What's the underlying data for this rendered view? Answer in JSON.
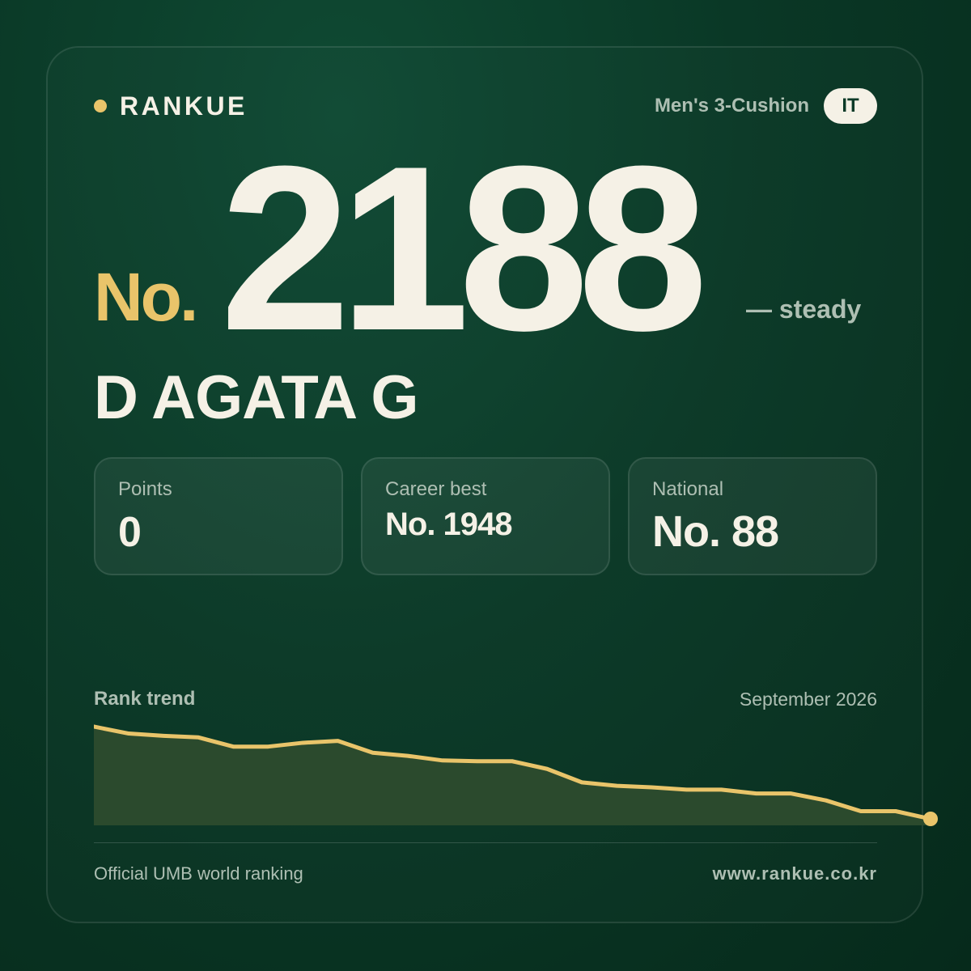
{
  "brand": {
    "name": "RANKUE",
    "accent_color": "#e9c46a"
  },
  "header": {
    "category": "Men's 3-Cushion",
    "country_code": "IT"
  },
  "rank": {
    "prefix": "No.",
    "value": "2188",
    "change": "— steady"
  },
  "player": {
    "name": "D AGATA G"
  },
  "stats": [
    {
      "label": "Points",
      "value": "0"
    },
    {
      "label": "Career best",
      "value": "No. 1948"
    },
    {
      "label": "National",
      "value": "No. 88"
    }
  ],
  "trend": {
    "label": "Rank trend",
    "period": "September 2026"
  },
  "chart_data": {
    "type": "area",
    "line_color": "#e9c46a",
    "fill_color": "#2b4a2d",
    "y_inverted": true,
    "values": [
      1948,
      1966,
      1972,
      1976,
      2000,
      2000,
      1990,
      1985,
      2016,
      2024,
      2036,
      2038,
      2038,
      2058,
      2093,
      2102,
      2106,
      2112,
      2112,
      2122,
      2122,
      2140,
      2168,
      2168,
      2188
    ]
  },
  "footer": {
    "source": "Official UMB world ranking",
    "url": "www.rankue.co.kr"
  }
}
